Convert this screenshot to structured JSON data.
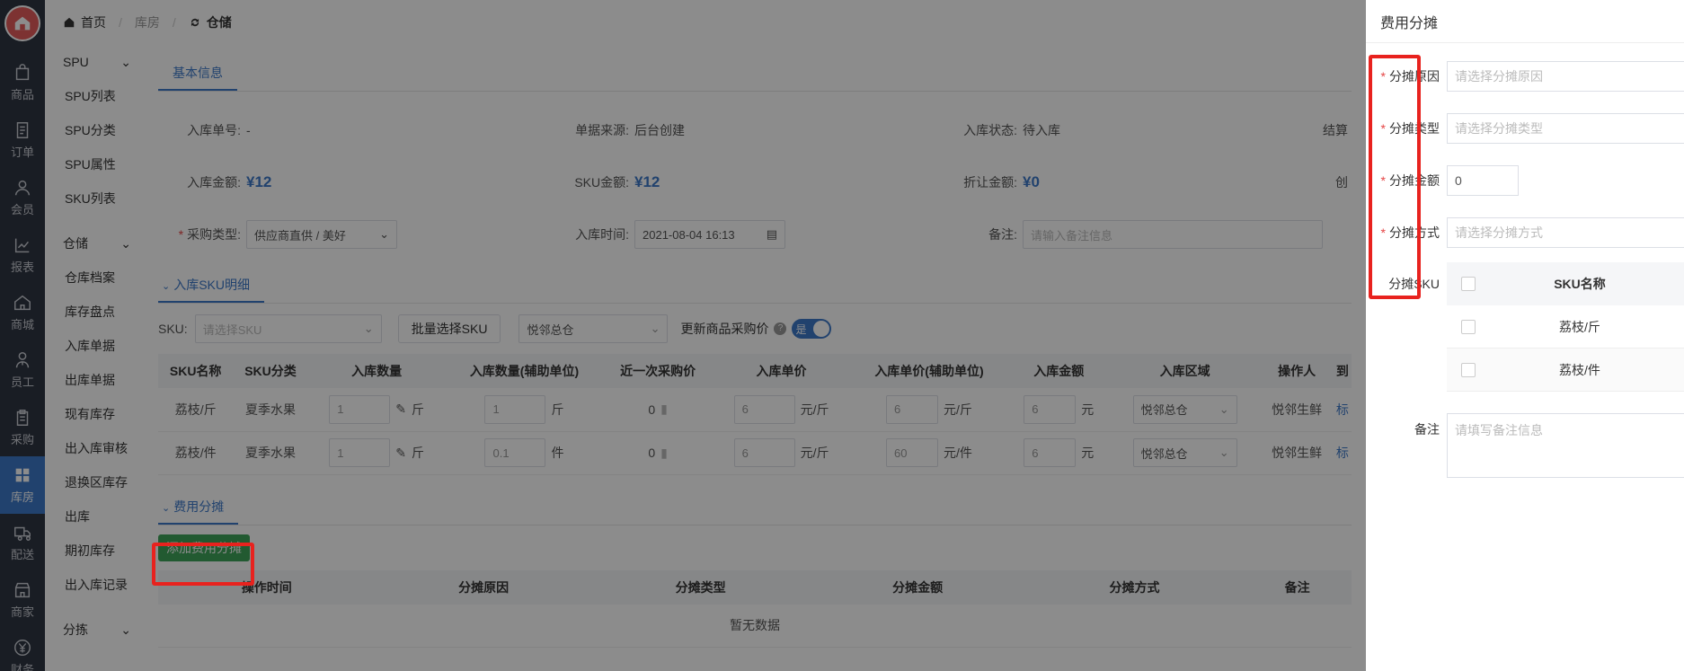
{
  "rail": [
    {
      "label": "商品",
      "icon": "bag-icon"
    },
    {
      "label": "订单",
      "icon": "document-icon"
    },
    {
      "label": "会员",
      "icon": "user-icon"
    },
    {
      "label": "报表",
      "icon": "chart-icon"
    },
    {
      "label": "商城",
      "icon": "home-icon"
    },
    {
      "label": "员工",
      "icon": "staff-icon"
    },
    {
      "label": "采购",
      "icon": "clipboard-icon"
    },
    {
      "label": "库房",
      "icon": "grid-icon",
      "active": true
    },
    {
      "label": "配送",
      "icon": "truck-icon"
    },
    {
      "label": "商家",
      "icon": "store-icon"
    },
    {
      "label": "财务",
      "icon": "yen-icon"
    }
  ],
  "submenu": {
    "spu_group": "SPU",
    "spu_items": [
      "SPU列表",
      "SPU分类",
      "SPU属性",
      "SKU列表"
    ],
    "storage_group": "仓储",
    "storage_items": [
      "仓库档案",
      "库存盘点",
      "入库单据",
      "出库单据",
      "现有库存",
      "出入库审核",
      "退换区库存",
      "出库",
      "期初库存",
      "出入库记录"
    ],
    "sort_group": "分拣"
  },
  "breadcrumb": {
    "home": "首页",
    "level1": "库房",
    "level2": "仓储"
  },
  "basic": {
    "tab": "基本信息",
    "order_no_label": "入库单号:",
    "order_no": "-",
    "source_label": "单据来源:",
    "source": "后台创建",
    "status_label": "入库状态:",
    "status": "待入库",
    "settle_label": "结算",
    "amount_label": "入库金额:",
    "amount": "¥12",
    "sku_amount_label": "SKU金额:",
    "sku_amount": "¥12",
    "discount_label": "折让金额:",
    "discount": "¥0",
    "created_label": "创",
    "purchase_type_label": "采购类型:",
    "purchase_type": "供应商直供 / 美好",
    "in_time_label": "入库时间:",
    "in_time": "2021-08-04 16:13",
    "remark_label": "备注:",
    "remark_placeholder": "请输入备注信息"
  },
  "sku_section": {
    "title": "入库SKU明细",
    "sku_label": "SKU:",
    "sku_placeholder": "请选择SKU",
    "batch_button": "批量选择SKU",
    "warehouse": "悦邻总仓",
    "update_price_label": "更新商品采购价",
    "switch_label": "是",
    "columns": [
      "SKU名称",
      "SKU分类",
      "入库数量",
      "入库数量(辅助单位)",
      "近一次采购价",
      "入库单价",
      "入库单价(辅助单位)",
      "入库金额",
      "入库区域",
      "操作人",
      "到"
    ],
    "rows": [
      {
        "name": "荔枝/斤",
        "category": "夏季水果",
        "qty": "1",
        "qty_unit": "斤",
        "aux_qty": "1",
        "aux_unit": "斤",
        "last_price": "0",
        "price": "6",
        "price_unit": "元/斤",
        "aux_price": "6",
        "aux_price_unit": "元/斤",
        "amount": "6",
        "amount_unit": "元",
        "area": "悦邻总仓",
        "operator": "悦邻生鲜",
        "link": "标"
      },
      {
        "name": "荔枝/件",
        "category": "夏季水果",
        "qty": "1",
        "qty_unit": "斤",
        "aux_qty": "0.1",
        "aux_unit": "件",
        "last_price": "0",
        "price": "6",
        "price_unit": "元/斤",
        "aux_price": "60",
        "aux_price_unit": "元/件",
        "amount": "6",
        "amount_unit": "元",
        "area": "悦邻总仓",
        "operator": "悦邻生鲜",
        "link": "标"
      }
    ]
  },
  "cost_section": {
    "title": "费用分摊",
    "add_button": "添加费用分摊",
    "columns": [
      "操作时间",
      "分摊原因",
      "分摊类型",
      "分摊金额",
      "分摊方式",
      "备注"
    ],
    "empty": "暂无数据"
  },
  "drawer": {
    "title": "费用分摊",
    "reason_label": "分摊原因",
    "reason_placeholder": "请选择分摊原因",
    "type_label": "分摊类型",
    "type_placeholder": "请选择分摊类型",
    "amount_label": "分摊金额",
    "amount_value": "0",
    "method_label": "分摊方式",
    "method_placeholder": "请选择分摊方式",
    "sku_label": "分摊SKU",
    "sku_header": "SKU名称",
    "sku_rows": [
      "荔枝/斤",
      "荔枝/件"
    ],
    "remark_label": "备注",
    "remark_placeholder": "请填写备注信息"
  },
  "colors": {
    "accent": "#3c78c8",
    "highlight": "#e8221e",
    "green": "#3ea55a"
  }
}
